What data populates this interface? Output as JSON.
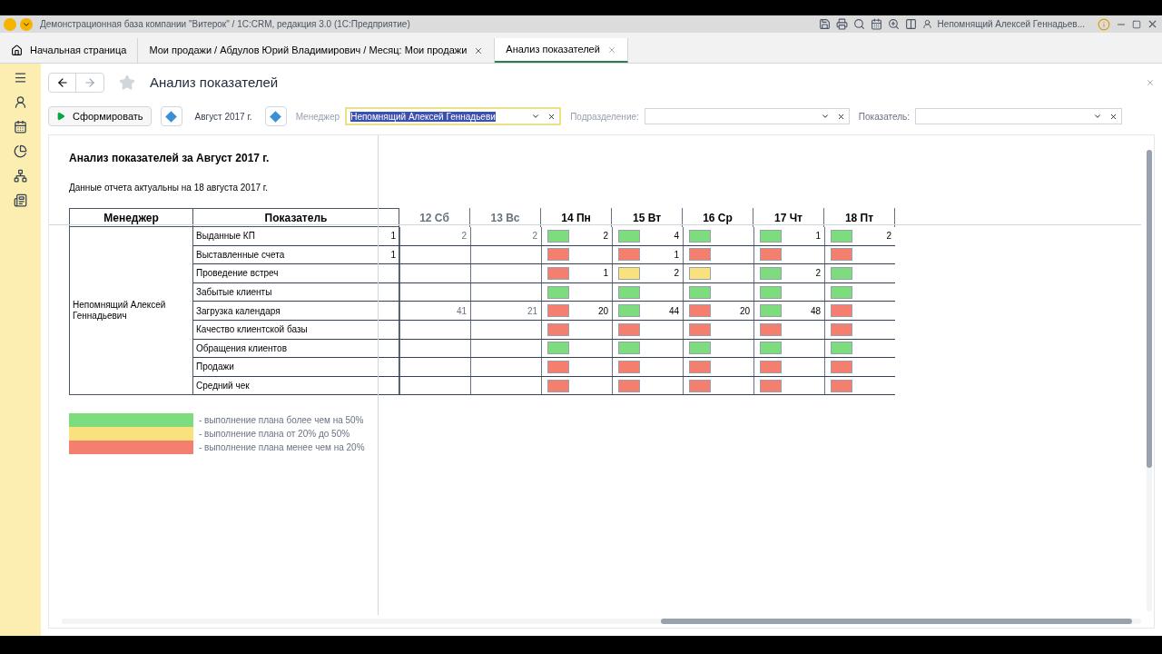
{
  "window": {
    "title": "Демонстрационная база компании \"Витерок\" / 1С:CRM, редакция 3.0 (1С:Предприятие)",
    "user": "Непомнящий Алексей Геннадьев..."
  },
  "tabs": [
    {
      "label": "Начальная страница",
      "kind": "home",
      "selected": false
    },
    {
      "label": "Мои продажи / Абдулов Юрий Владимирович / Месяц: Мои продажи",
      "kind": "doc",
      "selected": false
    },
    {
      "label": "Анализ показателей",
      "kind": "doc",
      "selected": true
    }
  ],
  "page": {
    "title": "Анализ показателей"
  },
  "toolbar": {
    "generate": "Сформировать",
    "period": "Август 2017 г.",
    "manager_label": "Менеджер",
    "manager_value": "Непомнящий Алексей Геннадьеви",
    "manager_text_selected": true,
    "department_label": "Подразделение:",
    "indicator_label": "Показатель:"
  },
  "report": {
    "title": "Анализ показателей за Август 2017 г.",
    "subtitle": "Данные отчета актуальны на 18 августа 2017 г.",
    "columns": [
      "Менеджер",
      "Показатель"
    ],
    "manager": "Непомнящий Алексей Геннадьевич",
    "days": [
      {
        "label": "12 Сб",
        "weekend": true
      },
      {
        "label": "13 Вс",
        "weekend": true
      },
      {
        "label": "14 Пн",
        "weekend": false
      },
      {
        "label": "15 Вт",
        "weekend": false
      },
      {
        "label": "16 Ср",
        "weekend": false
      },
      {
        "label": "17 Чт",
        "weekend": false
      },
      {
        "label": "18 Пт",
        "weekend": false
      }
    ],
    "rows": [
      {
        "indicator": "Выданные КП",
        "total": "1",
        "cells": [
          {
            "value": "2"
          },
          {
            "value": "2"
          },
          {
            "color": "#7ddc7d",
            "value": "2"
          },
          {
            "color": "#7ddc7d",
            "value": "4"
          },
          {
            "color": "#7ddc7d"
          },
          {
            "color": "#7ddc7d",
            "value": "1"
          },
          {
            "color": "#7ddc7d",
            "value": "2"
          }
        ]
      },
      {
        "indicator": "Выставленные счета",
        "total": "1",
        "cells": [
          {},
          {},
          {
            "color": "#f47f6e"
          },
          {
            "color": "#f47f6e",
            "value": "1"
          },
          {
            "color": "#f47f6e"
          },
          {
            "color": "#f47f6e"
          },
          {
            "color": "#f47f6e"
          }
        ]
      },
      {
        "indicator": "Проведение встреч",
        "cells": [
          {},
          {},
          {
            "color": "#f47f6e",
            "value": "1"
          },
          {
            "color": "#f9e27d",
            "value": "2"
          },
          {
            "color": "#f9e27d"
          },
          {
            "color": "#7ddc7d",
            "value": "2"
          },
          {
            "color": "#7ddc7d"
          }
        ]
      },
      {
        "indicator": "Забытые клиенты",
        "cells": [
          {},
          {},
          {
            "color": "#7ddc7d"
          },
          {
            "color": "#7ddc7d"
          },
          {
            "color": "#7ddc7d"
          },
          {
            "color": "#7ddc7d"
          },
          {
            "color": "#7ddc7d"
          }
        ]
      },
      {
        "indicator": "Загрузка календаря",
        "cells": [
          {
            "value": "41"
          },
          {
            "value": "21"
          },
          {
            "color": "#f47f6e",
            "value": "20"
          },
          {
            "color": "#7ddc7d",
            "value": "44"
          },
          {
            "color": "#f47f6e",
            "value": "20"
          },
          {
            "color": "#7ddc7d",
            "value": "48"
          },
          {
            "color": "#f47f6e"
          }
        ]
      },
      {
        "indicator": "Качество клиентской базы",
        "cells": [
          {},
          {},
          {
            "color": "#f47f6e"
          },
          {
            "color": "#f47f6e"
          },
          {
            "color": "#f47f6e"
          },
          {
            "color": "#f47f6e"
          },
          {
            "color": "#f47f6e"
          }
        ]
      },
      {
        "indicator": "Обращения клиентов",
        "cells": [
          {},
          {},
          {
            "color": "#7ddc7d"
          },
          {
            "color": "#7ddc7d"
          },
          {
            "color": "#7ddc7d"
          },
          {
            "color": "#7ddc7d"
          },
          {
            "color": "#7ddc7d"
          }
        ]
      },
      {
        "indicator": "Продажи",
        "cells": [
          {},
          {},
          {
            "color": "#f47f6e"
          },
          {
            "color": "#f47f6e"
          },
          {
            "color": "#f47f6e"
          },
          {
            "color": "#f47f6e"
          },
          {
            "color": "#f47f6e"
          }
        ]
      },
      {
        "indicator": "Средний чек",
        "cells": [
          {},
          {},
          {
            "color": "#f47f6e"
          },
          {
            "color": "#f47f6e"
          },
          {
            "color": "#f47f6e"
          },
          {
            "color": "#f47f6e"
          },
          {
            "color": "#f47f6e"
          }
        ]
      }
    ],
    "legend": [
      {
        "color": "#7ddc7d",
        "text": "- выполнение плана более чем на 50%"
      },
      {
        "color": "#f9e27d",
        "text": "- выполнение плана  от 20% до 50%"
      },
      {
        "color": "#f47f6e",
        "text": "- выполнение плана менее чем на 20%"
      }
    ]
  }
}
